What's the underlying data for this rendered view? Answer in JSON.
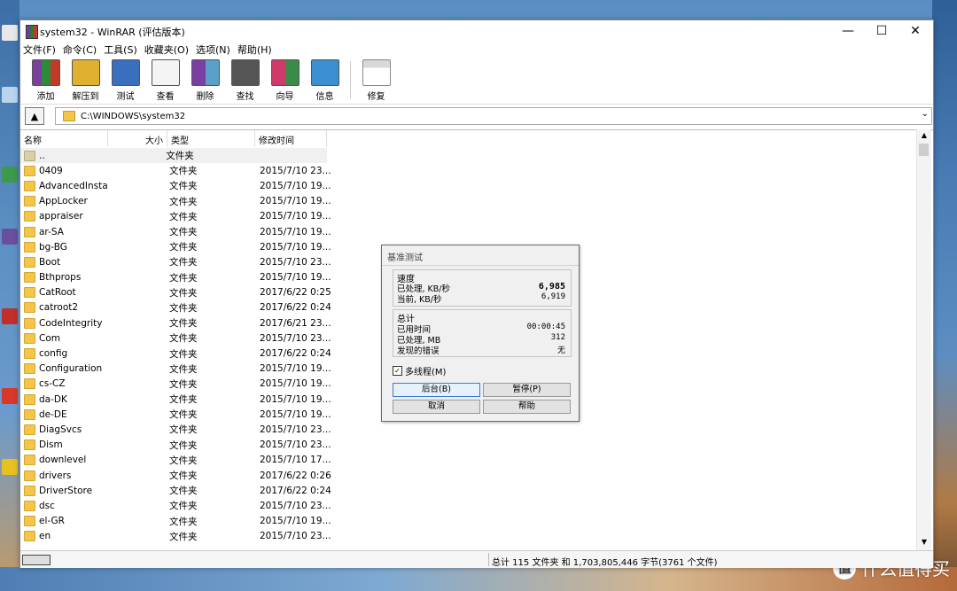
{
  "window": {
    "title": "system32 - WinRAR (评估版本)",
    "minimize": "—",
    "maximize": "☐",
    "close": "✕"
  },
  "menu": [
    "文件(F)",
    "命令(C)",
    "工具(S)",
    "收藏夹(O)",
    "选项(N)",
    "帮助(H)"
  ],
  "toolbar": [
    {
      "label": "添加",
      "icon": "add-archive-icon",
      "color": "#7a3fa0"
    },
    {
      "label": "解压到",
      "icon": "extract-to-icon",
      "color": "#e0b030"
    },
    {
      "label": "测试",
      "icon": "test-icon",
      "color": "#3a6fc0"
    },
    {
      "label": "查看",
      "icon": "view-icon",
      "color": "#c8c8c8"
    },
    {
      "label": "删除",
      "icon": "delete-icon",
      "color": "#5aa0c8"
    },
    {
      "label": "查找",
      "icon": "find-icon",
      "color": "#555555"
    },
    {
      "label": "向导",
      "icon": "wizard-icon",
      "color": "#d03a6a"
    },
    {
      "label": "信息",
      "icon": "info-icon",
      "color": "#3a8fd0"
    },
    {
      "label": "修复",
      "icon": "repair-icon",
      "color": "#d8d8d8"
    }
  ],
  "address": {
    "path": "C:\\WINDOWS\\system32",
    "dropdown": "⌄",
    "up": "▲"
  },
  "columns": [
    "名称",
    "大小",
    "类型",
    "修改时间"
  ],
  "rows": [
    {
      "name": "..",
      "size": "",
      "type": "文件夹",
      "date": ""
    },
    {
      "name": "0409",
      "size": "",
      "type": "文件夹",
      "date": "2015/7/10 23..."
    },
    {
      "name": "AdvancedInsta...",
      "size": "",
      "type": "文件夹",
      "date": "2015/7/10 19..."
    },
    {
      "name": "AppLocker",
      "size": "",
      "type": "文件夹",
      "date": "2015/7/10 19..."
    },
    {
      "name": "appraiser",
      "size": "",
      "type": "文件夹",
      "date": "2015/7/10 19..."
    },
    {
      "name": "ar-SA",
      "size": "",
      "type": "文件夹",
      "date": "2015/7/10 19..."
    },
    {
      "name": "bg-BG",
      "size": "",
      "type": "文件夹",
      "date": "2015/7/10 19..."
    },
    {
      "name": "Boot",
      "size": "",
      "type": "文件夹",
      "date": "2015/7/10 23..."
    },
    {
      "name": "Bthprops",
      "size": "",
      "type": "文件夹",
      "date": "2015/7/10 19..."
    },
    {
      "name": "CatRoot",
      "size": "",
      "type": "文件夹",
      "date": "2017/6/22 0:25"
    },
    {
      "name": "catroot2",
      "size": "",
      "type": "文件夹",
      "date": "2017/6/22 0:24"
    },
    {
      "name": "CodeIntegrity",
      "size": "",
      "type": "文件夹",
      "date": "2017/6/21 23..."
    },
    {
      "name": "Com",
      "size": "",
      "type": "文件夹",
      "date": "2015/7/10 23..."
    },
    {
      "name": "config",
      "size": "",
      "type": "文件夹",
      "date": "2017/6/22 0:24"
    },
    {
      "name": "Configuration",
      "size": "",
      "type": "文件夹",
      "date": "2015/7/10 19..."
    },
    {
      "name": "cs-CZ",
      "size": "",
      "type": "文件夹",
      "date": "2015/7/10 19..."
    },
    {
      "name": "da-DK",
      "size": "",
      "type": "文件夹",
      "date": "2015/7/10 19..."
    },
    {
      "name": "de-DE",
      "size": "",
      "type": "文件夹",
      "date": "2015/7/10 19..."
    },
    {
      "name": "DiagSvcs",
      "size": "",
      "type": "文件夹",
      "date": "2015/7/10 23..."
    },
    {
      "name": "Dism",
      "size": "",
      "type": "文件夹",
      "date": "2015/7/10 23..."
    },
    {
      "name": "downlevel",
      "size": "",
      "type": "文件夹",
      "date": "2015/7/10 17..."
    },
    {
      "name": "drivers",
      "size": "",
      "type": "文件夹",
      "date": "2017/6/22 0:26"
    },
    {
      "name": "DriverStore",
      "size": "",
      "type": "文件夹",
      "date": "2017/6/22 0:24"
    },
    {
      "name": "dsc",
      "size": "",
      "type": "文件夹",
      "date": "2015/7/10 23..."
    },
    {
      "name": "el-GR",
      "size": "",
      "type": "文件夹",
      "date": "2015/7/10 19..."
    },
    {
      "name": "en",
      "size": "",
      "type": "文件夹",
      "date": "2015/7/10 23..."
    }
  ],
  "status": {
    "text": "总计 115 文件夹 和 1,703,805,446 字节(3761 个文件)"
  },
  "dialog": {
    "title": "基准测试",
    "speed": {
      "title": "速度",
      "processed_label": "已处理, KB/秒",
      "processed_value": "6,985",
      "current_label": "当前, KB/秒",
      "current_value": "6,919"
    },
    "total": {
      "title": "总计",
      "elapsed_label": "已用时间",
      "elapsed_value": "00:00:45",
      "mb_label": "已处理, MB",
      "mb_value": "312",
      "errors_label": "发现的错误",
      "errors_value": "无"
    },
    "multithread_label": "多线程(M)",
    "multithread_checked": true,
    "buttons": {
      "background": "后台(B)",
      "pause": "暂停(P)",
      "cancel": "取消",
      "help": "帮助"
    }
  },
  "watermark": {
    "glyph": "值",
    "text": "什么值得买"
  },
  "colors": {
    "folder": "#f3c64a",
    "accent": "#3b79d6"
  }
}
